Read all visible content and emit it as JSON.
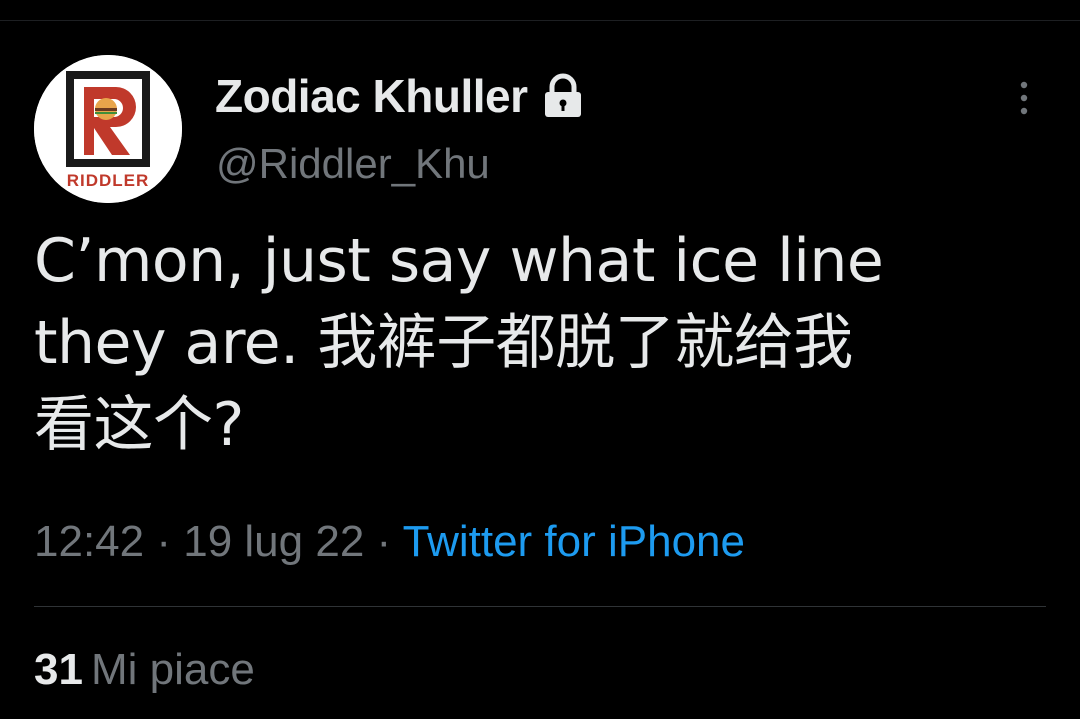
{
  "tweet": {
    "display_name": "Zodiac Khuller",
    "handle": "@Riddler_Khu",
    "protected_icon": "lock-icon",
    "avatar": {
      "letter": "R",
      "wordmark": "RIDDLER",
      "accent_color": "#c0392b"
    },
    "text": "C’mon, just say what ice line\nthey are. 我裤子都脱了就给我\n看这个?",
    "time": "12:42",
    "separator": "·",
    "date": "19 lug 22",
    "source": "Twitter for iPhone",
    "more_icon": "more-vertical-icon"
  },
  "stats": {
    "likes_count": "31",
    "likes_label": "Mi piace"
  },
  "colors": {
    "background": "#000000",
    "primary_text": "#e7e9ea",
    "secondary_text": "#71767b",
    "link": "#1d9bf0",
    "divider": "#2f3336"
  }
}
